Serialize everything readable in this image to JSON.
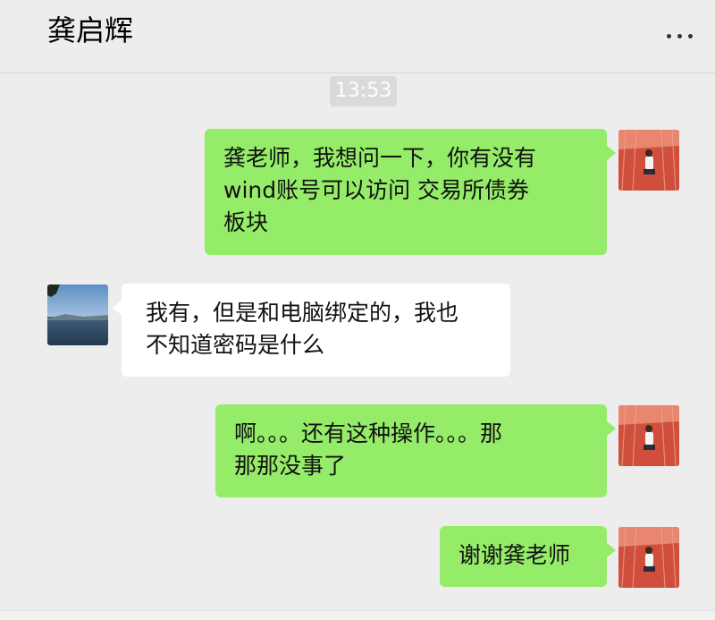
{
  "header": {
    "title": "龚启辉",
    "more_icon": "more-dots-icon"
  },
  "timestamp": "13:53",
  "messages": [
    {
      "sender": "self",
      "lines": [
        "龚老师，我想问一下，你有没有",
        "wind账号可以访问  交易所债券",
        "板块"
      ]
    },
    {
      "sender": "other",
      "lines": [
        "我有，但是和电脑绑定的，我也",
        "不知道密码是什么"
      ]
    },
    {
      "sender": "self",
      "lines": [
        "啊。。。还有这种操作。。。那",
        "那那没事了"
      ]
    },
    {
      "sender": "self",
      "lines": [
        "谢谢龚老师"
      ]
    }
  ],
  "colors": {
    "background": "#ededed",
    "self_bubble": "#95ec69",
    "other_bubble": "#ffffff",
    "time_badge": "#dadada"
  }
}
